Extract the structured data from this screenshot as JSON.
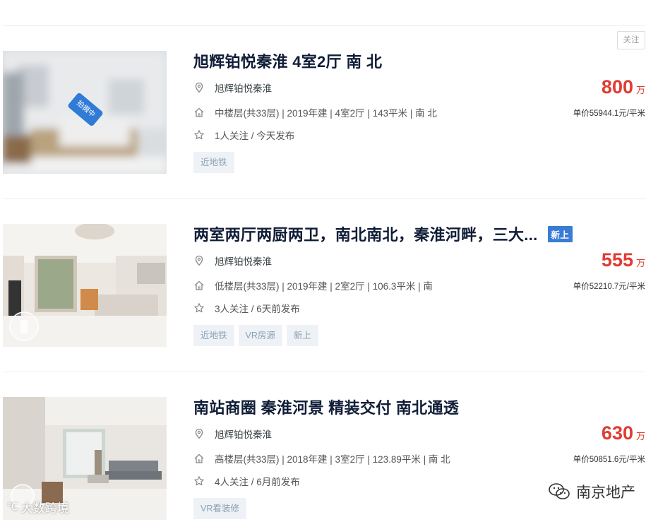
{
  "follow_button": "关注",
  "listings": [
    {
      "title": "旭辉铂悦秦淮 4室2厅 南 北",
      "community": "旭辉铂悦秦淮",
      "info": "中楼层(共33层) | 2019年建 | 4室2厅 | 143平米 | 南 北",
      "follow": "1人关注 / 今天发布",
      "tags": [
        "近地铁"
      ],
      "price": "800",
      "price_unit": "万",
      "unit_price": "单价55944.1元/平米",
      "photo_badge": "拍摄中"
    },
    {
      "title": "两室两厅两厨两卫，南北南北，秦淮河畔，三大...",
      "new_badge": "新上",
      "community": "旭辉铂悦秦淮",
      "info": "低楼层(共33层) | 2019年建 | 2室2厅 | 106.3平米 | 南",
      "follow": "3人关注 / 6天前发布",
      "tags": [
        "近地铁",
        "VR房源",
        "新上"
      ],
      "price": "555",
      "price_unit": "万",
      "unit_price": "单价52210.7元/平米"
    },
    {
      "title": "南站商圈 秦淮河景 精装交付 南北通透",
      "community": "旭辉铂悦秦淮",
      "info": "高楼层(共33层) | 2018年建 | 3室2厅 | 123.89平米 | 南 北",
      "follow": "4人关注 / 6月前发布",
      "tags": [
        "VR看装修"
      ],
      "price": "630",
      "price_unit": "万",
      "unit_price": "单价50851.6元/平米"
    }
  ],
  "watermark": "南京地产",
  "photo_watermark": "大数跨境",
  "icons": {
    "location": "location-pin-icon",
    "house": "house-icon",
    "star": "star-icon",
    "wechat": "wechat-icon"
  },
  "colors": {
    "price": "#e03b32",
    "title": "#101d37",
    "tag_bg": "#eef2f6",
    "tag_text": "#8aa0b4",
    "new_badge": "#3a7bd5"
  }
}
